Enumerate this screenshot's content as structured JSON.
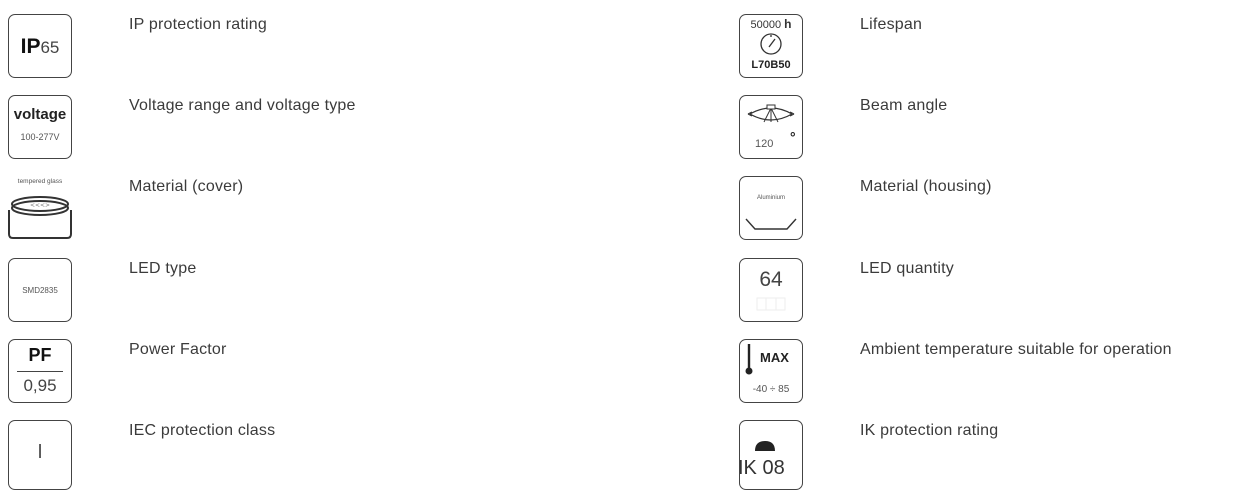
{
  "left": [
    {
      "label": "IP protection rating",
      "icon": {
        "name": "ip-rating-icon",
        "prefix": "IP",
        "value": "65"
      }
    },
    {
      "label": "Voltage range and voltage type",
      "icon": {
        "name": "voltage-icon",
        "title": "voltage",
        "value": "100-277V"
      }
    },
    {
      "label": "Material (cover)",
      "icon": {
        "name": "cover-material-icon",
        "value": "tempered glass"
      }
    },
    {
      "label": "LED type",
      "icon": {
        "name": "led-type-icon",
        "value": "SMD2835"
      }
    },
    {
      "label": "Power Factor",
      "icon": {
        "name": "power-factor-icon",
        "title": "PF",
        "value": "0,95"
      }
    },
    {
      "label": "IEC protection class",
      "icon": {
        "name": "iec-class-icon",
        "value": "I"
      }
    }
  ],
  "right": [
    {
      "label": "Lifespan",
      "icon": {
        "name": "lifespan-clock-icon",
        "value": "50000",
        "unit": "h",
        "sub": "L70B50"
      }
    },
    {
      "label": "Beam angle",
      "icon": {
        "name": "beam-angle-icon",
        "value": "120",
        "unit": "°"
      }
    },
    {
      "label": "Material (housing)",
      "icon": {
        "name": "housing-material-icon",
        "value": "Aluminium"
      }
    },
    {
      "label": "LED quantity",
      "icon": {
        "name": "led-quantity-icon",
        "value": "64"
      }
    },
    {
      "label": "Ambient temperature suitable for operation",
      "icon": {
        "name": "thermometer-icon",
        "title": "MAX",
        "value": "-40 ÷ 85"
      }
    },
    {
      "label": "IK protection rating",
      "icon": {
        "name": "ik-rating-icon",
        "value": "IK 08"
      }
    }
  ]
}
